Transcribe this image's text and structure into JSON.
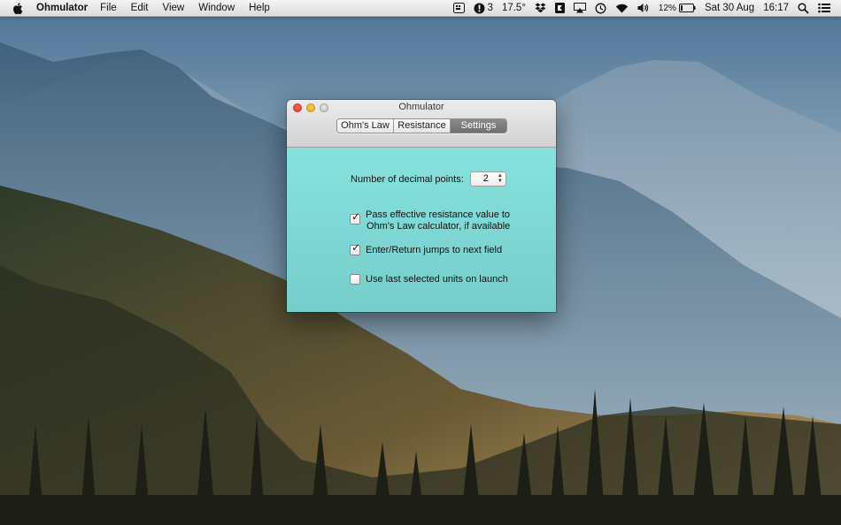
{
  "menubar": {
    "app_name": "Ohmulator",
    "menus": [
      "File",
      "Edit",
      "View",
      "Window",
      "Help"
    ],
    "status": {
      "notification_count": "3",
      "temperature": "17.5°",
      "battery": "12%",
      "date": "Sat 30 Aug",
      "time": "16:17"
    }
  },
  "window": {
    "title": "Ohmulator",
    "tabs": [
      "Ohm's Law",
      "Resistance",
      "Settings"
    ],
    "active_tab": "Settings",
    "settings": {
      "decimal_label": "Number of decimal points:",
      "decimal_value": "2",
      "options": [
        {
          "label": "Pass effective resistance value to\nOhm's Law calculator, if available",
          "checked": true
        },
        {
          "label": "Enter/Return jumps to next field",
          "checked": true
        },
        {
          "label": "Use last selected units on launch",
          "checked": false
        }
      ]
    }
  },
  "colors": {
    "content_bg": "#80d9d6",
    "active_tab": "#7a7a7a"
  },
  "icons": [
    "apple-icon",
    "keyboard-viewer-icon",
    "notification-icon",
    "dropbox-icon",
    "app-badge-icon",
    "airplay-icon",
    "time-machine-icon",
    "wifi-icon",
    "volume-icon",
    "battery-icon",
    "spotlight-icon",
    "notification-center-icon"
  ]
}
